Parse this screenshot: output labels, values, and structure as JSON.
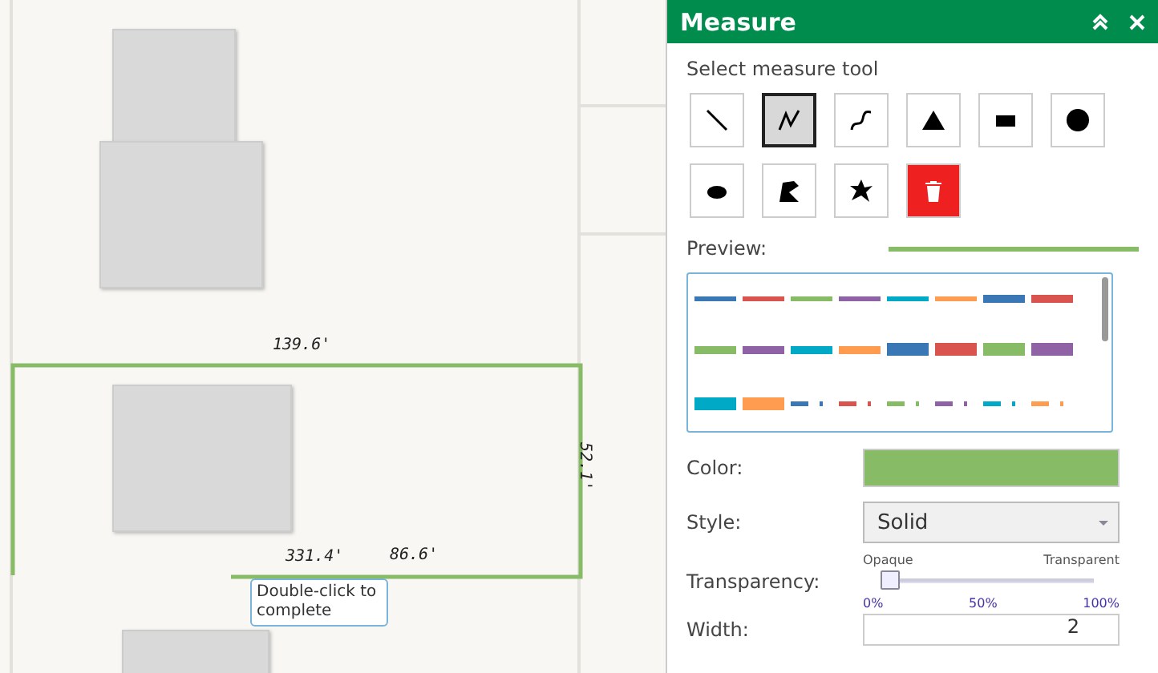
{
  "map": {
    "labels": [
      {
        "text": "139.6'",
        "kind": "horizontal"
      },
      {
        "text": "52.1'",
        "kind": "vertical"
      },
      {
        "text": "331.4'",
        "kind": "horizontal"
      },
      {
        "text": "86.6'",
        "kind": "horizontal"
      }
    ],
    "tooltip": "Double-click to complete"
  },
  "panel": {
    "title": "Measure",
    "tool_prompt": "Select measure tool",
    "tools": [
      {
        "kind": "line",
        "selected": false
      },
      {
        "kind": "polyline",
        "selected": true
      },
      {
        "kind": "freehand",
        "selected": false
      },
      {
        "kind": "triangle",
        "selected": false
      },
      {
        "kind": "rectangle",
        "selected": false
      },
      {
        "kind": "circle",
        "selected": false
      },
      {
        "kind": "ellipse",
        "selected": false
      },
      {
        "kind": "polygon",
        "selected": false
      },
      {
        "kind": "freehand-polygon",
        "selected": false
      },
      {
        "kind": "delete",
        "selected": false
      }
    ],
    "preview_label": "Preview:",
    "swatches": [
      {
        "color": "#3a78b5",
        "kind": "thin"
      },
      {
        "color": "#d9534f",
        "kind": "thin"
      },
      {
        "color": "#88bb66",
        "kind": "thin"
      },
      {
        "color": "#8e62a4",
        "kind": "thin"
      },
      {
        "color": "#00a9c5",
        "kind": "thin"
      },
      {
        "color": "#ff9c4f",
        "kind": "thin"
      },
      {
        "color": "#3a78b5",
        "kind": "medium"
      },
      {
        "color": "#d9534f",
        "kind": "medium"
      },
      {
        "color": "#88bb66",
        "kind": "medium"
      },
      {
        "color": "#8e62a4",
        "kind": "medium"
      },
      {
        "color": "#00a9c5",
        "kind": "medium"
      },
      {
        "color": "#ff9c4f",
        "kind": "medium"
      },
      {
        "color": "#3a78b5",
        "kind": "thick"
      },
      {
        "color": "#d9534f",
        "kind": "thick"
      },
      {
        "color": "#88bb66",
        "kind": "thick"
      },
      {
        "color": "#8e62a4",
        "kind": "thick"
      },
      {
        "color": "#00a9c5",
        "kind": "thick"
      },
      {
        "color": "#ff9c4f",
        "kind": "thick"
      },
      {
        "color": "#3a78b5",
        "kind": "dashdot"
      },
      {
        "color": "#d9534f",
        "kind": "dashdot"
      },
      {
        "color": "#88bb66",
        "kind": "dashdot"
      },
      {
        "color": "#8e62a4",
        "kind": "dashdot"
      },
      {
        "color": "#00a9c5",
        "kind": "dashdot"
      },
      {
        "color": "#ff9c4f",
        "kind": "dashdot"
      }
    ],
    "color_label": "Color:",
    "color": "#88bb66",
    "style_label": "Style:",
    "style_value": "Solid",
    "transparency": {
      "label": "Transparency:",
      "min": "Opaque",
      "max": "Transparent",
      "level": 0,
      "ticks": [
        "0%",
        "50%",
        "100%"
      ]
    },
    "width_label": "Width:",
    "width_value": "2"
  }
}
